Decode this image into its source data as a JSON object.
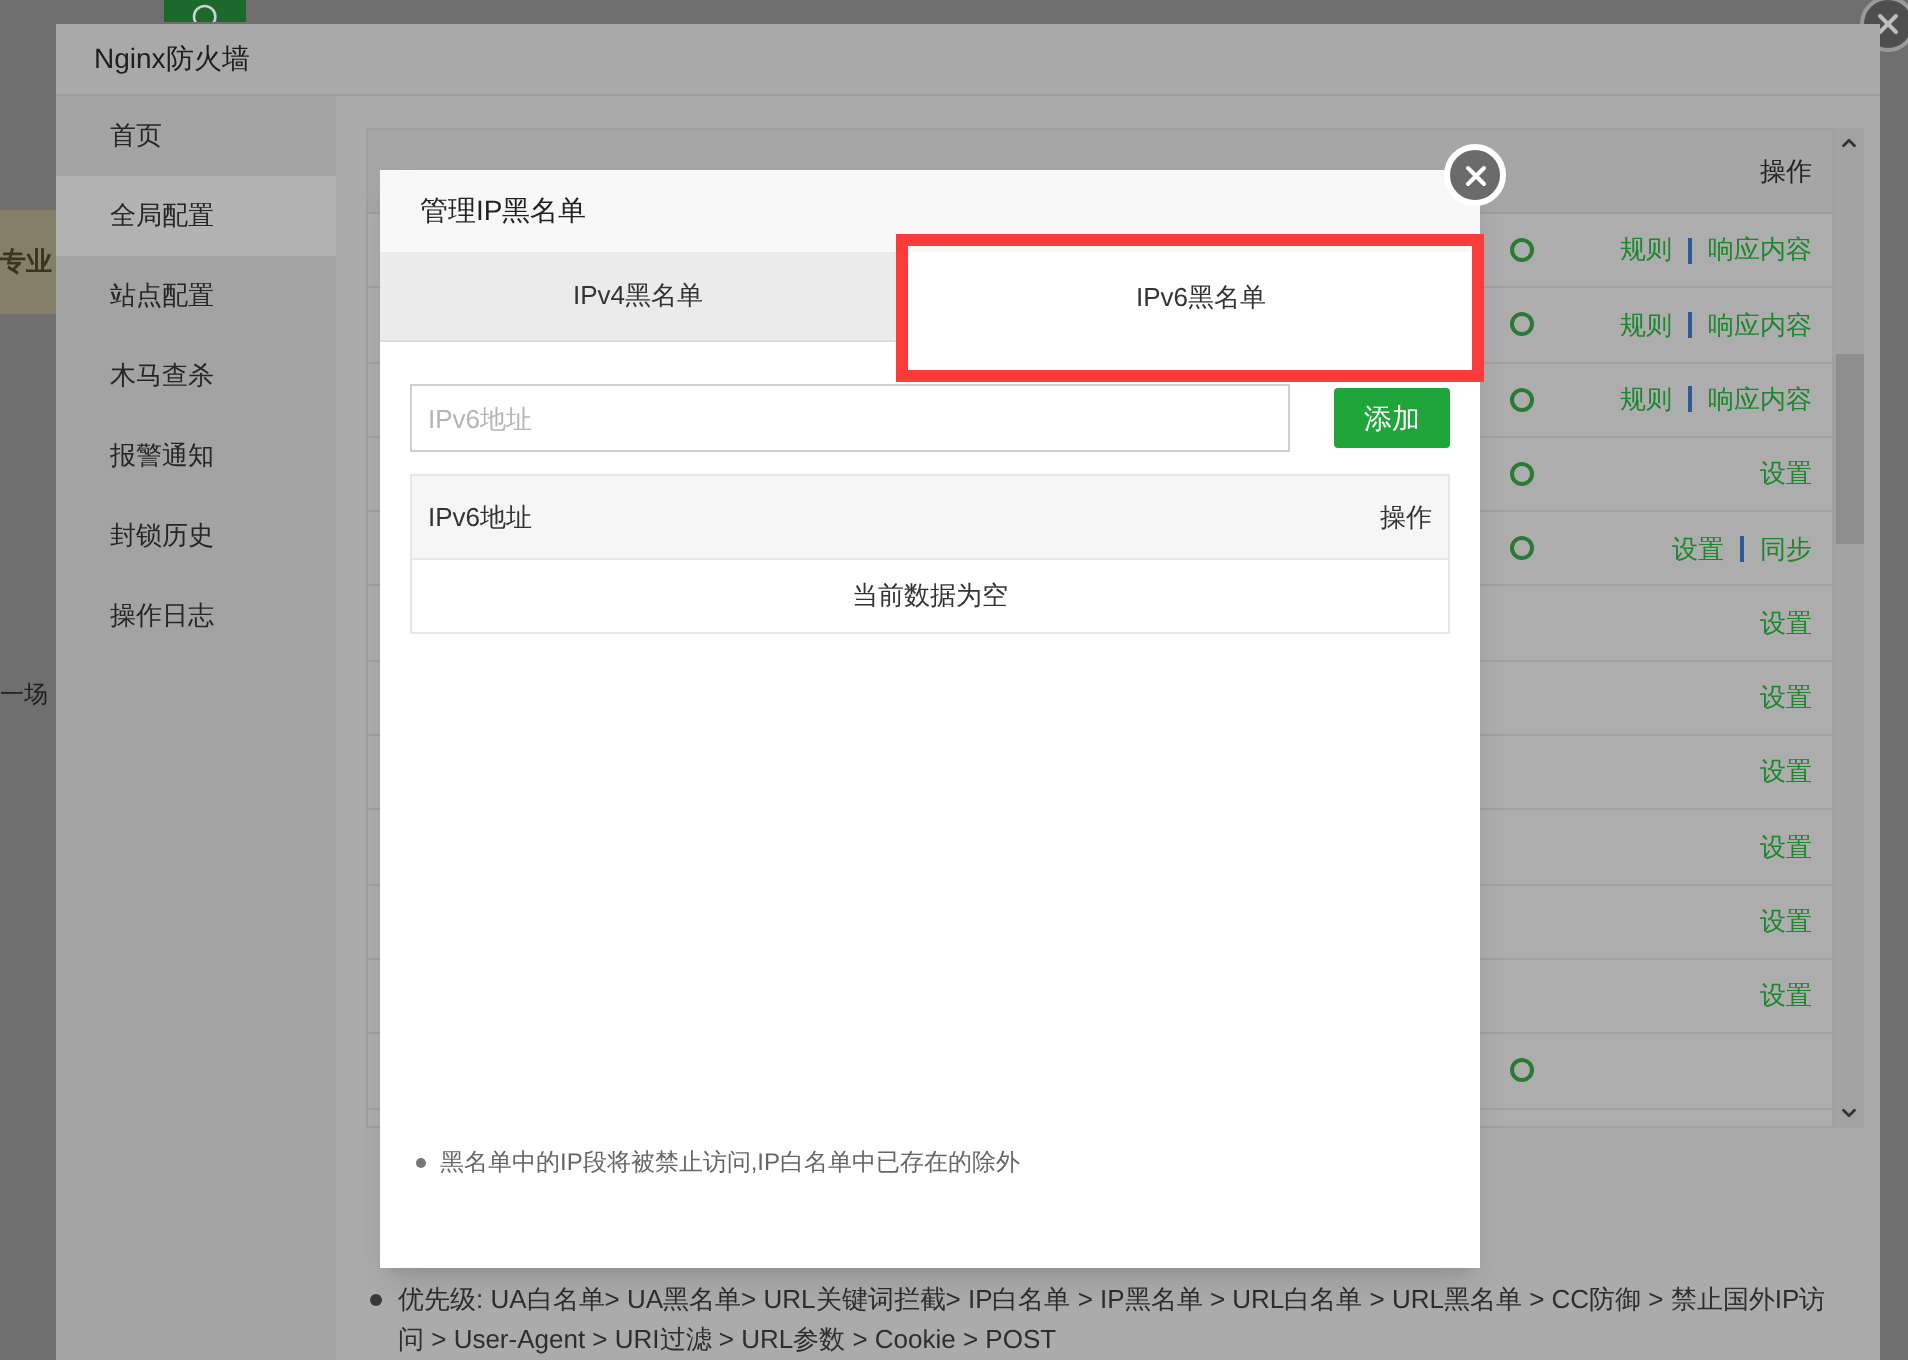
{
  "background": {
    "fragments": [
      "专业",
      "一场"
    ]
  },
  "window": {
    "title": "Nginx防火墙"
  },
  "sidebar": {
    "items": [
      {
        "label": "首页",
        "selected": false
      },
      {
        "label": "全局配置",
        "selected": true
      },
      {
        "label": "站点配置",
        "selected": false
      },
      {
        "label": "木马查杀",
        "selected": false
      },
      {
        "label": "报警通知",
        "selected": false
      },
      {
        "label": "封锁历史",
        "selected": false
      },
      {
        "label": "操作日志",
        "selected": false
      }
    ]
  },
  "table": {
    "columns": [
      "操作"
    ],
    "rows": [
      {
        "switch": true,
        "actions": [
          "规则",
          "响应内容"
        ]
      },
      {
        "switch": true,
        "actions": [
          "规则",
          "响应内容"
        ]
      },
      {
        "switch": true,
        "actions": [
          "规则",
          "响应内容"
        ]
      },
      {
        "switch": true,
        "actions": [
          "设置"
        ]
      },
      {
        "switch": true,
        "actions": [
          "设置",
          "同步"
        ]
      },
      {
        "switch": false,
        "actions": [
          "设置"
        ]
      },
      {
        "switch": false,
        "actions": [
          "设置"
        ]
      },
      {
        "switch": false,
        "actions": [
          "设置"
        ]
      },
      {
        "switch": false,
        "actions": [
          "设置"
        ]
      },
      {
        "switch": false,
        "actions": [
          "设置"
        ]
      },
      {
        "switch": false,
        "actions": [
          "设置"
        ]
      },
      {
        "switch": true,
        "actions": []
      }
    ]
  },
  "notes": [
    "优先级: UA白名单> UA黑名单> URL关键词拦截> IP白名单 > IP黑名单 > URL白名单 > URL黑名单 > CC防御 > 禁止国外IP访问 > User-Agent > URI过滤 > URL参数 > Cookie > POST"
  ],
  "modal": {
    "title": "管理IP黑名单",
    "tabs": [
      {
        "label": "IPv4黑名单",
        "selected": false
      },
      {
        "label": "IPv6黑名单",
        "selected": true
      }
    ],
    "input": {
      "placeholder": "IPv6地址"
    },
    "add_button": "添加",
    "list": {
      "columns": [
        "IPv6地址",
        "操作"
      ],
      "empty_text": "当前数据为空"
    },
    "note": "黑名单中的IP段将被禁止访问,IP白名单中已存在的除外"
  }
}
